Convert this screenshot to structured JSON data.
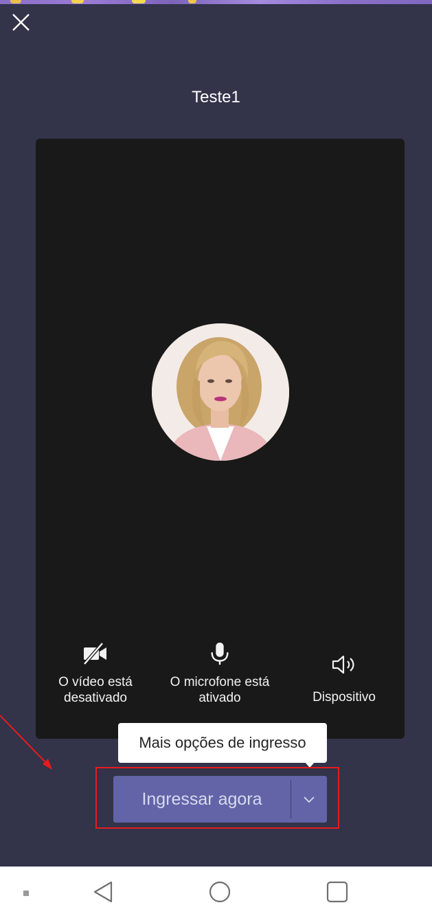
{
  "meeting": {
    "title": "Teste1"
  },
  "controls": {
    "video_label_line1": "O vídeo está",
    "video_label_line2": "desativado",
    "mic_label_line1": "O microfone está",
    "mic_label_line2": "ativado",
    "device_label": "Dispositivo"
  },
  "tooltip": {
    "text": "Mais opções de ingresso"
  },
  "join": {
    "label": "Ingressar agora"
  },
  "icons": {
    "close": "close-icon",
    "video_off": "video-off-icon",
    "mic": "microphone-icon",
    "speaker": "speaker-icon",
    "chevron": "chevron-down-icon",
    "back": "nav-back-icon",
    "home": "nav-home-icon",
    "recents": "nav-recents-icon"
  },
  "colors": {
    "background": "#33334a",
    "panel": "#191919",
    "join_button": "#6264a7",
    "highlight": "#e51c1c"
  }
}
